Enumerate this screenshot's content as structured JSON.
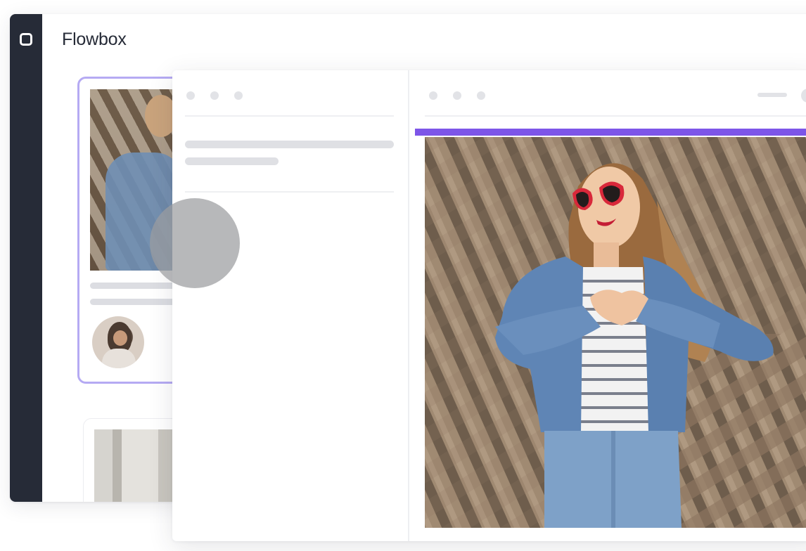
{
  "app": {
    "name": "Flowbox"
  },
  "colors": {
    "rail": "#262b37",
    "accent": "#7d55e8",
    "selection_border": "#b5aaf3",
    "placeholder": "#dfe0e4"
  },
  "icons": {
    "app_logo": "rounded-square-logo-icon"
  }
}
